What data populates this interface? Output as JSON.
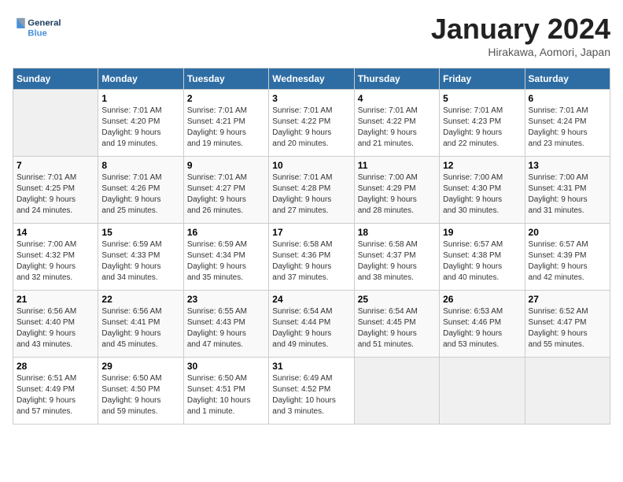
{
  "header": {
    "logo_line1": "General",
    "logo_line2": "Blue",
    "title": "January 2024",
    "subtitle": "Hirakawa, Aomori, Japan"
  },
  "weekdays": [
    "Sunday",
    "Monday",
    "Tuesday",
    "Wednesday",
    "Thursday",
    "Friday",
    "Saturday"
  ],
  "weeks": [
    [
      {
        "day": "",
        "info": ""
      },
      {
        "day": "1",
        "info": "Sunrise: 7:01 AM\nSunset: 4:20 PM\nDaylight: 9 hours\nand 19 minutes."
      },
      {
        "day": "2",
        "info": "Sunrise: 7:01 AM\nSunset: 4:21 PM\nDaylight: 9 hours\nand 19 minutes."
      },
      {
        "day": "3",
        "info": "Sunrise: 7:01 AM\nSunset: 4:22 PM\nDaylight: 9 hours\nand 20 minutes."
      },
      {
        "day": "4",
        "info": "Sunrise: 7:01 AM\nSunset: 4:22 PM\nDaylight: 9 hours\nand 21 minutes."
      },
      {
        "day": "5",
        "info": "Sunrise: 7:01 AM\nSunset: 4:23 PM\nDaylight: 9 hours\nand 22 minutes."
      },
      {
        "day": "6",
        "info": "Sunrise: 7:01 AM\nSunset: 4:24 PM\nDaylight: 9 hours\nand 23 minutes."
      }
    ],
    [
      {
        "day": "7",
        "info": "Sunrise: 7:01 AM\nSunset: 4:25 PM\nDaylight: 9 hours\nand 24 minutes."
      },
      {
        "day": "8",
        "info": "Sunrise: 7:01 AM\nSunset: 4:26 PM\nDaylight: 9 hours\nand 25 minutes."
      },
      {
        "day": "9",
        "info": "Sunrise: 7:01 AM\nSunset: 4:27 PM\nDaylight: 9 hours\nand 26 minutes."
      },
      {
        "day": "10",
        "info": "Sunrise: 7:01 AM\nSunset: 4:28 PM\nDaylight: 9 hours\nand 27 minutes."
      },
      {
        "day": "11",
        "info": "Sunrise: 7:00 AM\nSunset: 4:29 PM\nDaylight: 9 hours\nand 28 minutes."
      },
      {
        "day": "12",
        "info": "Sunrise: 7:00 AM\nSunset: 4:30 PM\nDaylight: 9 hours\nand 30 minutes."
      },
      {
        "day": "13",
        "info": "Sunrise: 7:00 AM\nSunset: 4:31 PM\nDaylight: 9 hours\nand 31 minutes."
      }
    ],
    [
      {
        "day": "14",
        "info": "Sunrise: 7:00 AM\nSunset: 4:32 PM\nDaylight: 9 hours\nand 32 minutes."
      },
      {
        "day": "15",
        "info": "Sunrise: 6:59 AM\nSunset: 4:33 PM\nDaylight: 9 hours\nand 34 minutes."
      },
      {
        "day": "16",
        "info": "Sunrise: 6:59 AM\nSunset: 4:34 PM\nDaylight: 9 hours\nand 35 minutes."
      },
      {
        "day": "17",
        "info": "Sunrise: 6:58 AM\nSunset: 4:36 PM\nDaylight: 9 hours\nand 37 minutes."
      },
      {
        "day": "18",
        "info": "Sunrise: 6:58 AM\nSunset: 4:37 PM\nDaylight: 9 hours\nand 38 minutes."
      },
      {
        "day": "19",
        "info": "Sunrise: 6:57 AM\nSunset: 4:38 PM\nDaylight: 9 hours\nand 40 minutes."
      },
      {
        "day": "20",
        "info": "Sunrise: 6:57 AM\nSunset: 4:39 PM\nDaylight: 9 hours\nand 42 minutes."
      }
    ],
    [
      {
        "day": "21",
        "info": "Sunrise: 6:56 AM\nSunset: 4:40 PM\nDaylight: 9 hours\nand 43 minutes."
      },
      {
        "day": "22",
        "info": "Sunrise: 6:56 AM\nSunset: 4:41 PM\nDaylight: 9 hours\nand 45 minutes."
      },
      {
        "day": "23",
        "info": "Sunrise: 6:55 AM\nSunset: 4:43 PM\nDaylight: 9 hours\nand 47 minutes."
      },
      {
        "day": "24",
        "info": "Sunrise: 6:54 AM\nSunset: 4:44 PM\nDaylight: 9 hours\nand 49 minutes."
      },
      {
        "day": "25",
        "info": "Sunrise: 6:54 AM\nSunset: 4:45 PM\nDaylight: 9 hours\nand 51 minutes."
      },
      {
        "day": "26",
        "info": "Sunrise: 6:53 AM\nSunset: 4:46 PM\nDaylight: 9 hours\nand 53 minutes."
      },
      {
        "day": "27",
        "info": "Sunrise: 6:52 AM\nSunset: 4:47 PM\nDaylight: 9 hours\nand 55 minutes."
      }
    ],
    [
      {
        "day": "28",
        "info": "Sunrise: 6:51 AM\nSunset: 4:49 PM\nDaylight: 9 hours\nand 57 minutes."
      },
      {
        "day": "29",
        "info": "Sunrise: 6:50 AM\nSunset: 4:50 PM\nDaylight: 9 hours\nand 59 minutes."
      },
      {
        "day": "30",
        "info": "Sunrise: 6:50 AM\nSunset: 4:51 PM\nDaylight: 10 hours\nand 1 minute."
      },
      {
        "day": "31",
        "info": "Sunrise: 6:49 AM\nSunset: 4:52 PM\nDaylight: 10 hours\nand 3 minutes."
      },
      {
        "day": "",
        "info": ""
      },
      {
        "day": "",
        "info": ""
      },
      {
        "day": "",
        "info": ""
      }
    ]
  ]
}
